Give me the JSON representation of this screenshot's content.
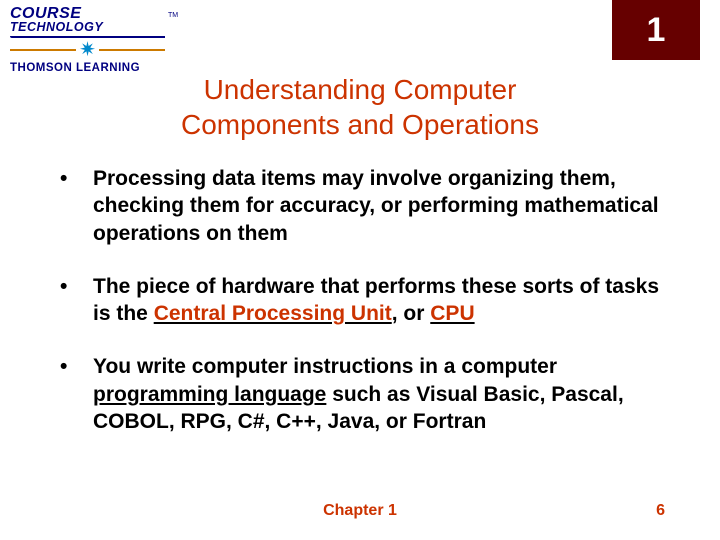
{
  "logo": {
    "line1": "COURSE",
    "line2": "TECHNOLOGY",
    "tm": "TM",
    "line3": "THOMSON LEARNING"
  },
  "chapter_badge": "1",
  "title": "Understanding Computer Components and Operations",
  "bullets": {
    "b1": {
      "text": "Processing data items may involve organizing them, checking them for accuracy, or performing mathematical operations on them"
    },
    "b2": {
      "pre": "The piece of hardware that performs these sorts of tasks is the ",
      "hl1": "Central Processing Unit",
      "mid": ", or ",
      "hl2": "CPU"
    },
    "b3": {
      "pre": "You write computer instructions in a computer ",
      "hl1": "programming language",
      "post": " such as Visual Basic, Pascal, COBOL, RPG, C#, C++, Java, or Fortran"
    }
  },
  "footer": {
    "chapter": "Chapter 1",
    "page": "6"
  }
}
